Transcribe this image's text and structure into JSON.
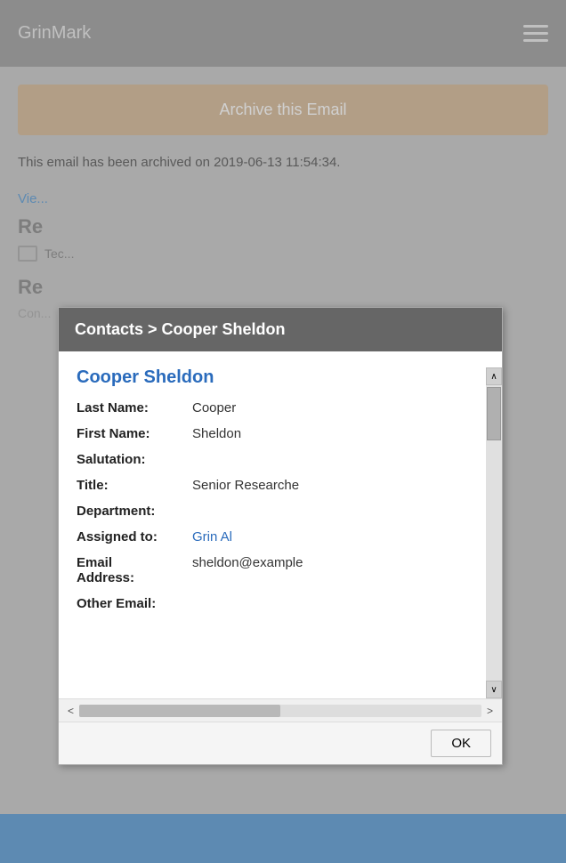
{
  "app": {
    "title": "GrinMark"
  },
  "archive_button": {
    "label": "Archive this Email"
  },
  "archived_notice": {
    "text": "This email has been archived on 2019-06-13 11:54:34."
  },
  "view_link": {
    "text": "Vie..."
  },
  "section1": {
    "label": "Re"
  },
  "section2": {
    "label": "Re"
  },
  "contact_partial": {
    "text": "Con..."
  },
  "modal": {
    "header": "Contacts > Cooper Sheldon",
    "contact_name": "Cooper Sheldon",
    "fields": [
      {
        "label": "Last Name:",
        "value": "Cooper",
        "type": "text"
      },
      {
        "label": "First Name:",
        "value": "Sheldon",
        "type": "text"
      },
      {
        "label": "Salutation:",
        "value": "",
        "type": "text"
      },
      {
        "label": "Title:",
        "value": "Senior Researche",
        "type": "text"
      },
      {
        "label": "Department:",
        "value": "",
        "type": "text"
      },
      {
        "label": "Assigned to:",
        "value": "Grin Al",
        "type": "link"
      },
      {
        "label": "Email Address:",
        "value": "sheldon@example",
        "type": "text"
      },
      {
        "label": "Other Email:",
        "value": "",
        "type": "text"
      }
    ],
    "ok_label": "OK"
  }
}
